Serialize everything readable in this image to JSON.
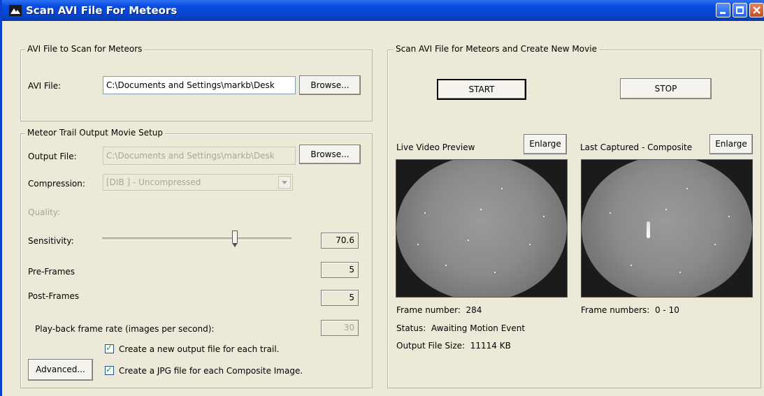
{
  "window": {
    "title": "Scan AVI File For Meteors"
  },
  "avi_group": {
    "legend": "AVI File to Scan for Meteors",
    "avi_file_label": "AVI File:",
    "avi_file_value": "C:\\Documents and Settings\\markb\\Desk",
    "browse_label": "Browse..."
  },
  "output_group": {
    "legend": "Meteor Trail Output Movie Setup",
    "output_file_label": "Output File:",
    "output_file_value": "C:\\Documents and Settings\\markb\\Desk",
    "browse_label": "Browse...",
    "compression_label": "Compression:",
    "compression_value": "[DIB ] - Uncompressed",
    "quality_label": "Quality:",
    "sensitivity_label": "Sensitivity:",
    "sensitivity_value": "70.6",
    "sensitivity_fraction": 0.706,
    "preframes_label": "Pre-Frames",
    "preframes_value": "5",
    "postframes_label": "Post-Frames",
    "postframes_value": "5",
    "playback_label": "Play-back frame rate (images per second):",
    "playback_value": "30",
    "new_output_label": "Create a new output file for each trail.",
    "jpg_label": "Create a JPG file for each Composite Image.",
    "advanced_label": "Advanced..."
  },
  "scan_group": {
    "legend": "Scan AVI File for Meteors and Create New Movie",
    "start_label": "START",
    "stop_label": "STOP",
    "live_label": "Live Video Preview",
    "last_label": "Last Captured - Composite",
    "enlarge_label": "Enlarge",
    "frame_number_label": "Frame number:",
    "frame_number_value": "284",
    "status_label": "Status:",
    "status_value": "Awaiting Motion Event",
    "output_size_label": "Output File Size:",
    "output_size_value": "11114 KB",
    "frame_numbers_label": "Frame numbers:",
    "frame_numbers_value": "0 - 10"
  }
}
